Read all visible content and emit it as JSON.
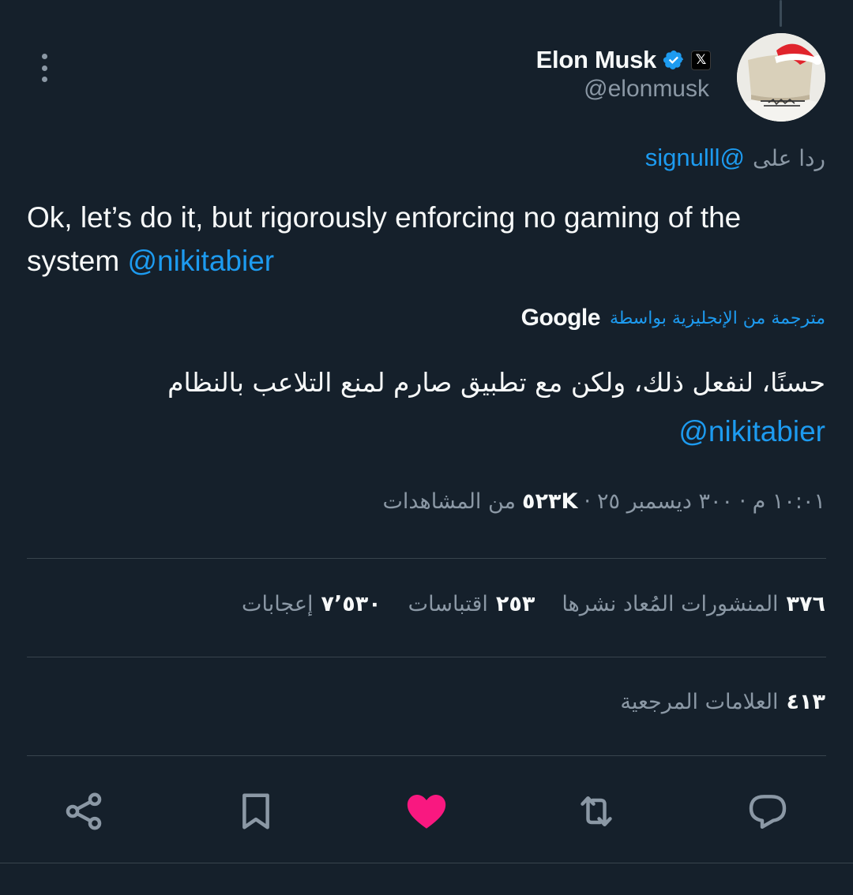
{
  "author": {
    "display_name": "Elon Musk",
    "handle": "@elonmusk",
    "verified_icon": "verified-badge-icon",
    "affiliation_icon": "x-logo-icon",
    "affiliation_mark": "𝕏"
  },
  "reply": {
    "prefix": "ردا على",
    "to": "@signulll"
  },
  "tweet": {
    "text": "Ok, let’s do it, but rigorously enforcing no gaming of the system",
    "mention": "@nikitabier"
  },
  "translation": {
    "label": "مترجمة من الإنجليزية بواسطة",
    "provider": "Google",
    "text": "حسنًا، لنفعل ذلك، ولكن مع تطبيق صارم لمنع التلاعب بالنظام",
    "mention": "@nikitabier"
  },
  "meta": {
    "time": "١٠:٠١ م",
    "date": "٣٠٠ ديسمبر ٢٥",
    "views_count": "٥٢٣K",
    "views_label": "من المشاهدات",
    "separator": "·"
  },
  "stats": {
    "reposts": {
      "count": "٣٧٦",
      "label": "المنشورات المُعاد نشرها"
    },
    "quotes": {
      "count": "٢٥٣",
      "label": "اقتباسات"
    },
    "likes": {
      "count": "٧٬٥٣٠",
      "label": "إعجابات"
    },
    "bookmarks": {
      "count": "٤١٣",
      "label": "العلامات المرجعية"
    }
  },
  "actions": [
    {
      "icon": "share-icon"
    },
    {
      "icon": "bookmark-icon"
    },
    {
      "icon": "heart-icon",
      "active": true,
      "color": "#f91880"
    },
    {
      "icon": "retweet-icon"
    },
    {
      "icon": "reply-icon"
    }
  ],
  "colors": {
    "background": "#15202b",
    "accent": "#1d9bf0",
    "muted": "#8b98a5",
    "like": "#f91880"
  }
}
